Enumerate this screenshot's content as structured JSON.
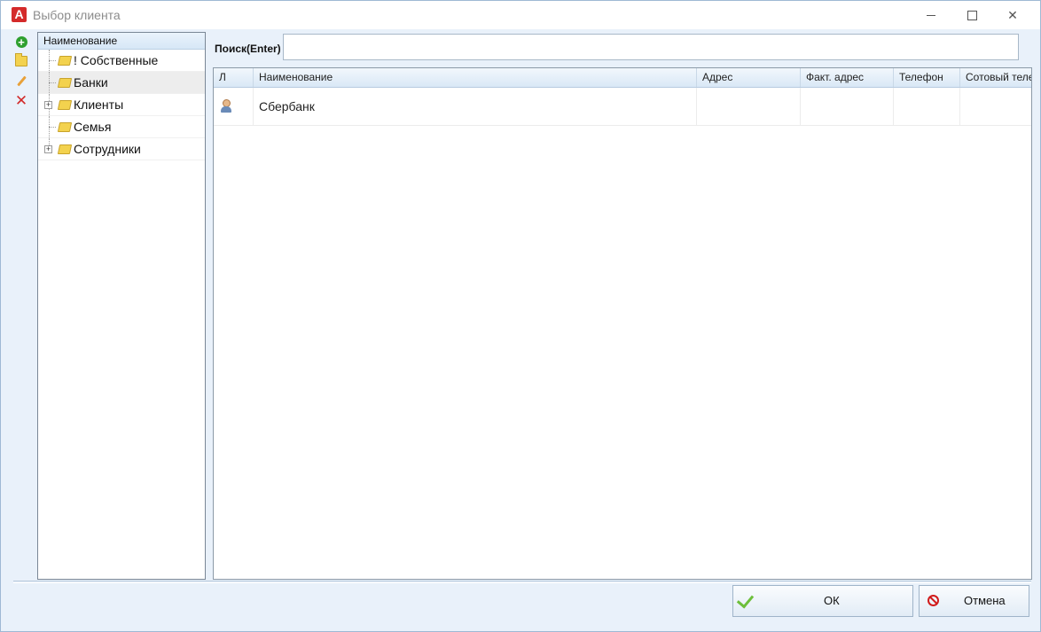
{
  "window": {
    "title": "Выбор клиента",
    "close_glyph": "✕"
  },
  "toolbar": {
    "icons": [
      "add-icon",
      "folder-icon",
      "edit-icon",
      "delete-icon"
    ],
    "add_glyph": "+",
    "delete_glyph": "✕"
  },
  "tree": {
    "header": "Наименование",
    "expander_glyph": "+",
    "items": [
      {
        "label": "! Собственные"
      },
      {
        "label": "Банки"
      },
      {
        "label": "Клиенты"
      },
      {
        "label": "Семья"
      },
      {
        "label": "Сотрудники"
      }
    ]
  },
  "search": {
    "label": "Поиск(Enter)",
    "value": ""
  },
  "grid": {
    "columns": [
      "Л",
      "Наименование",
      "Адрес",
      "Факт. адрес",
      "Телефон",
      "Сотовый теле"
    ],
    "rows": [
      {
        "icon": "person-icon",
        "name": "Сбербанк",
        "address": "",
        "fact_address": "",
        "phone": "",
        "mobile": ""
      }
    ]
  },
  "buttons": {
    "ok": "ОК",
    "cancel": "Отмена"
  },
  "colors": {
    "accent": "#e9f1fa",
    "app_icon": "#d42a2a",
    "ok_check": "#6dbf3b",
    "cancel_icon": "#d11c1c"
  }
}
